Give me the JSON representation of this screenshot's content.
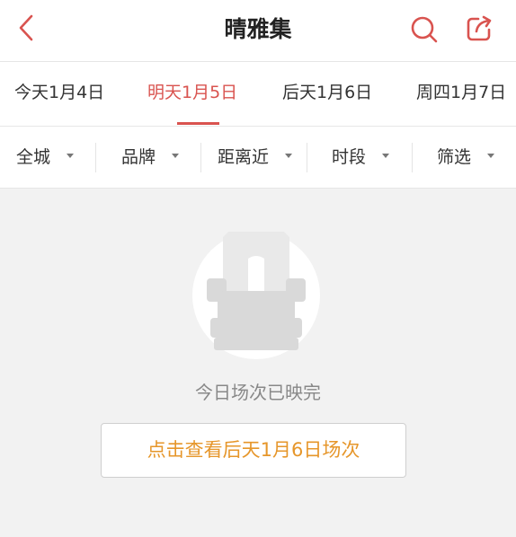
{
  "header": {
    "title": "晴雅集",
    "icons": {
      "back": "chevron-left-icon",
      "search": "search-icon",
      "share": "share-icon"
    }
  },
  "date_tabs": [
    {
      "label": "今天1月4日",
      "active": false
    },
    {
      "label": "明天1月5日",
      "active": true
    },
    {
      "label": "后天1月6日",
      "active": false
    },
    {
      "label": "周四1月7日",
      "active": false
    }
  ],
  "filters": [
    {
      "label": "全城"
    },
    {
      "label": "品牌"
    },
    {
      "label": "距离近"
    },
    {
      "label": "时段"
    },
    {
      "label": "筛选"
    }
  ],
  "empty_state": {
    "illustration": "cinema-seat-icon",
    "message": "今日场次已映完",
    "button_label": "点击查看后天1月6日场次"
  },
  "colors": {
    "accent": "#d9534f",
    "button_text": "#e6962a",
    "background": "#f2f2f2"
  }
}
